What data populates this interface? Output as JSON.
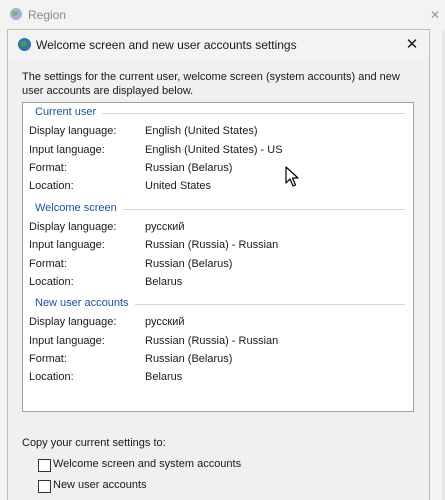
{
  "parent_window": {
    "title": "Region",
    "close_glyph": "✕"
  },
  "dialog": {
    "title": "Welcome screen and new user accounts settings",
    "close_glyph": "✕",
    "description": "The settings for the current user, welcome screen (system accounts) and new user accounts are displayed below."
  },
  "sections": [
    {
      "header": "Current user",
      "rows": [
        {
          "label": "Display language:",
          "value": "English (United States)"
        },
        {
          "label": "Input language:",
          "value": "English (United States) - US"
        },
        {
          "label": "Format:",
          "value": "Russian (Belarus)"
        },
        {
          "label": "Location:",
          "value": "United States"
        }
      ]
    },
    {
      "header": "Welcome screen",
      "rows": [
        {
          "label": "Display language:",
          "value": "русский"
        },
        {
          "label": "Input language:",
          "value": "Russian (Russia) - Russian"
        },
        {
          "label": "Format:",
          "value": "Russian (Belarus)"
        },
        {
          "label": "Location:",
          "value": "Belarus"
        }
      ]
    },
    {
      "header": "New user accounts",
      "rows": [
        {
          "label": "Display language:",
          "value": "русский"
        },
        {
          "label": "Input language:",
          "value": "Russian (Russia) - Russian"
        },
        {
          "label": "Format:",
          "value": "Russian (Belarus)"
        },
        {
          "label": "Location:",
          "value": "Belarus"
        }
      ]
    }
  ],
  "copy": {
    "label": "Copy your current settings to:",
    "options": [
      {
        "label": "Welcome screen and system accounts",
        "checked": false
      },
      {
        "label": "New user accounts",
        "checked": false
      }
    ]
  },
  "icons": {
    "parent": "globe-icon",
    "dialog": "globe-icon",
    "cursor": "mouse-cursor-icon"
  },
  "colors": {
    "section_header": "#1f4fa0",
    "window_bg": "#f0f0f0",
    "panel_bg": "#ffffff"
  }
}
